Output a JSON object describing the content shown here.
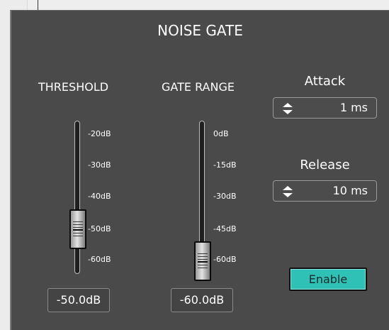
{
  "panel": {
    "title": "NOISE GATE"
  },
  "threshold": {
    "label": "THRESHOLD",
    "scale": [
      "-20dB",
      "-30dB",
      "-40dB",
      "-50dB",
      "-60dB"
    ],
    "value": "-50.0dB"
  },
  "gate_range": {
    "label": "GATE RANGE",
    "scale": [
      "0dB",
      "-15dB",
      "-30dB",
      "-45dB",
      "-60dB"
    ],
    "value": "-60.0dB"
  },
  "attack": {
    "label": "Attack",
    "value": "1 ms",
    "icon": "spinner-updown-icon"
  },
  "release": {
    "label": "Release",
    "value": "10 ms",
    "icon": "spinner-updown-icon"
  },
  "enable_button": {
    "label": "Enable",
    "color": "#2fc0b6"
  },
  "colors": {
    "panel_bg": "#4a4a4a",
    "text": "#ffffff",
    "accent": "#2fc0b6"
  }
}
